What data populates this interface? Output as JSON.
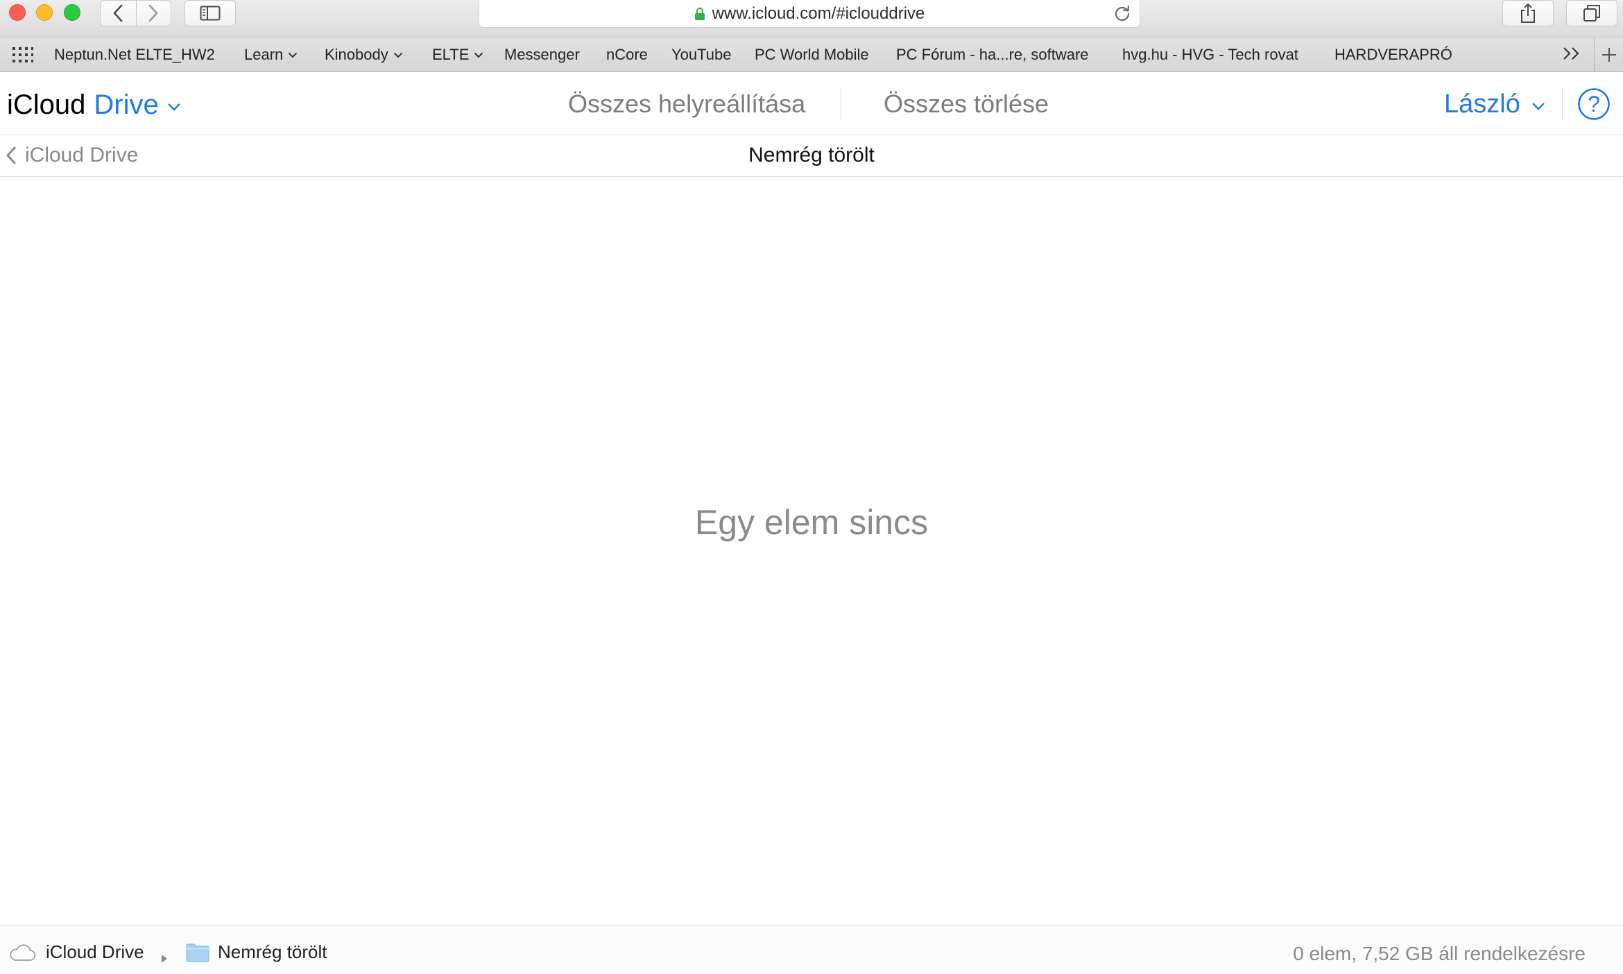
{
  "browser": {
    "url": "www.icloud.com/#iclouddrive",
    "bookmarks": [
      {
        "label": "Neptun.Net ELTE_HW2",
        "has_menu": false
      },
      {
        "label": "Learn",
        "has_menu": true
      },
      {
        "label": "Kinobody",
        "has_menu": true
      },
      {
        "label": "ELTE",
        "has_menu": true
      },
      {
        "label": "Messenger",
        "has_menu": false
      },
      {
        "label": "nCore",
        "has_menu": false
      },
      {
        "label": "YouTube",
        "has_menu": false
      },
      {
        "label": "PC World Mobile",
        "has_menu": false
      },
      {
        "label": "PC Fórum - ha...re, software",
        "has_menu": false
      },
      {
        "label": "hvg.hu - HVG - Tech rovat",
        "has_menu": false
      },
      {
        "label": "HARDVERAPRÓ",
        "has_menu": false
      }
    ],
    "icons": {
      "close": "close-window-icon",
      "minimize": "minimize-window-icon",
      "zoom": "zoom-window-icon",
      "back": "back-arrow-icon",
      "forward": "forward-arrow-icon",
      "sidebar": "sidebar-icon",
      "lock": "lock-icon",
      "reload": "reload-icon",
      "share": "share-icon",
      "tabs": "tabs-overview-icon",
      "apps_grid": "apps-grid-icon",
      "more": "double-chevron-right-icon",
      "new_tab": "plus-icon"
    }
  },
  "header": {
    "brand_primary": "iCloud",
    "brand_secondary": "Drive",
    "restore_all": "Összes helyreállítása",
    "delete_all": "Összes törlése",
    "user_name": "László",
    "help_symbol": "?"
  },
  "subheader": {
    "back_label": "iCloud Drive",
    "title": "Nemrég törölt"
  },
  "main": {
    "empty_message": "Egy elem sincs"
  },
  "footer": {
    "breadcrumb_root": "iCloud Drive",
    "breadcrumb_current": "Nemrég törölt",
    "status": "0 elem, 7,52 GB áll rendelkezésre"
  },
  "colors": {
    "accent": "#1f7ce0",
    "muted_text": "#8a8a8a",
    "folder": "#a9d3f1",
    "lock": "#2fb24c"
  }
}
